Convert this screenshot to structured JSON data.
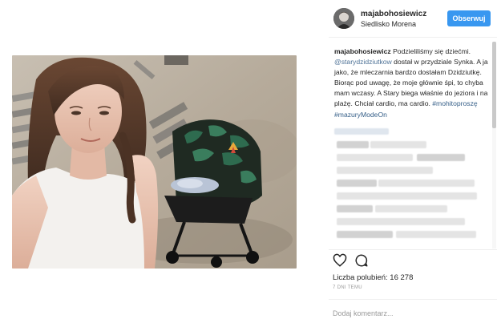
{
  "post": {
    "username": "majabohosiewicz",
    "location": "Siedlisko Morena",
    "follow_label": "Obserwuj"
  },
  "caption": {
    "username": "majabohosiewicz",
    "text_1": " Podzieliliśmy się dziećmi. ",
    "mention": "@starydzidziutkow",
    "text_2": " dostał w przydziale Synka. A ja jako, że mleczarnia bardzo dostałam Dzidziutkę. Biorąc pod uwagę, że moje głównie śpi, to chyba mam wczasy. A Stary biega właśnie do jeziora i na plażę. Chciał cardio, ma cardio. ",
    "hashtags": "#mohitoproszę #mazuryModeOn"
  },
  "engagement": {
    "likes_text": "Liczba polubień: 16 278",
    "timestamp": "7 DNI TEMU",
    "comment_placeholder": "Dodaj komentarz..."
  },
  "icons": {
    "like": "heart-icon",
    "comment": "speech-bubble-icon"
  },
  "colors": {
    "follow_button": "#3897f0",
    "link": "#003569",
    "muted": "#999999"
  }
}
